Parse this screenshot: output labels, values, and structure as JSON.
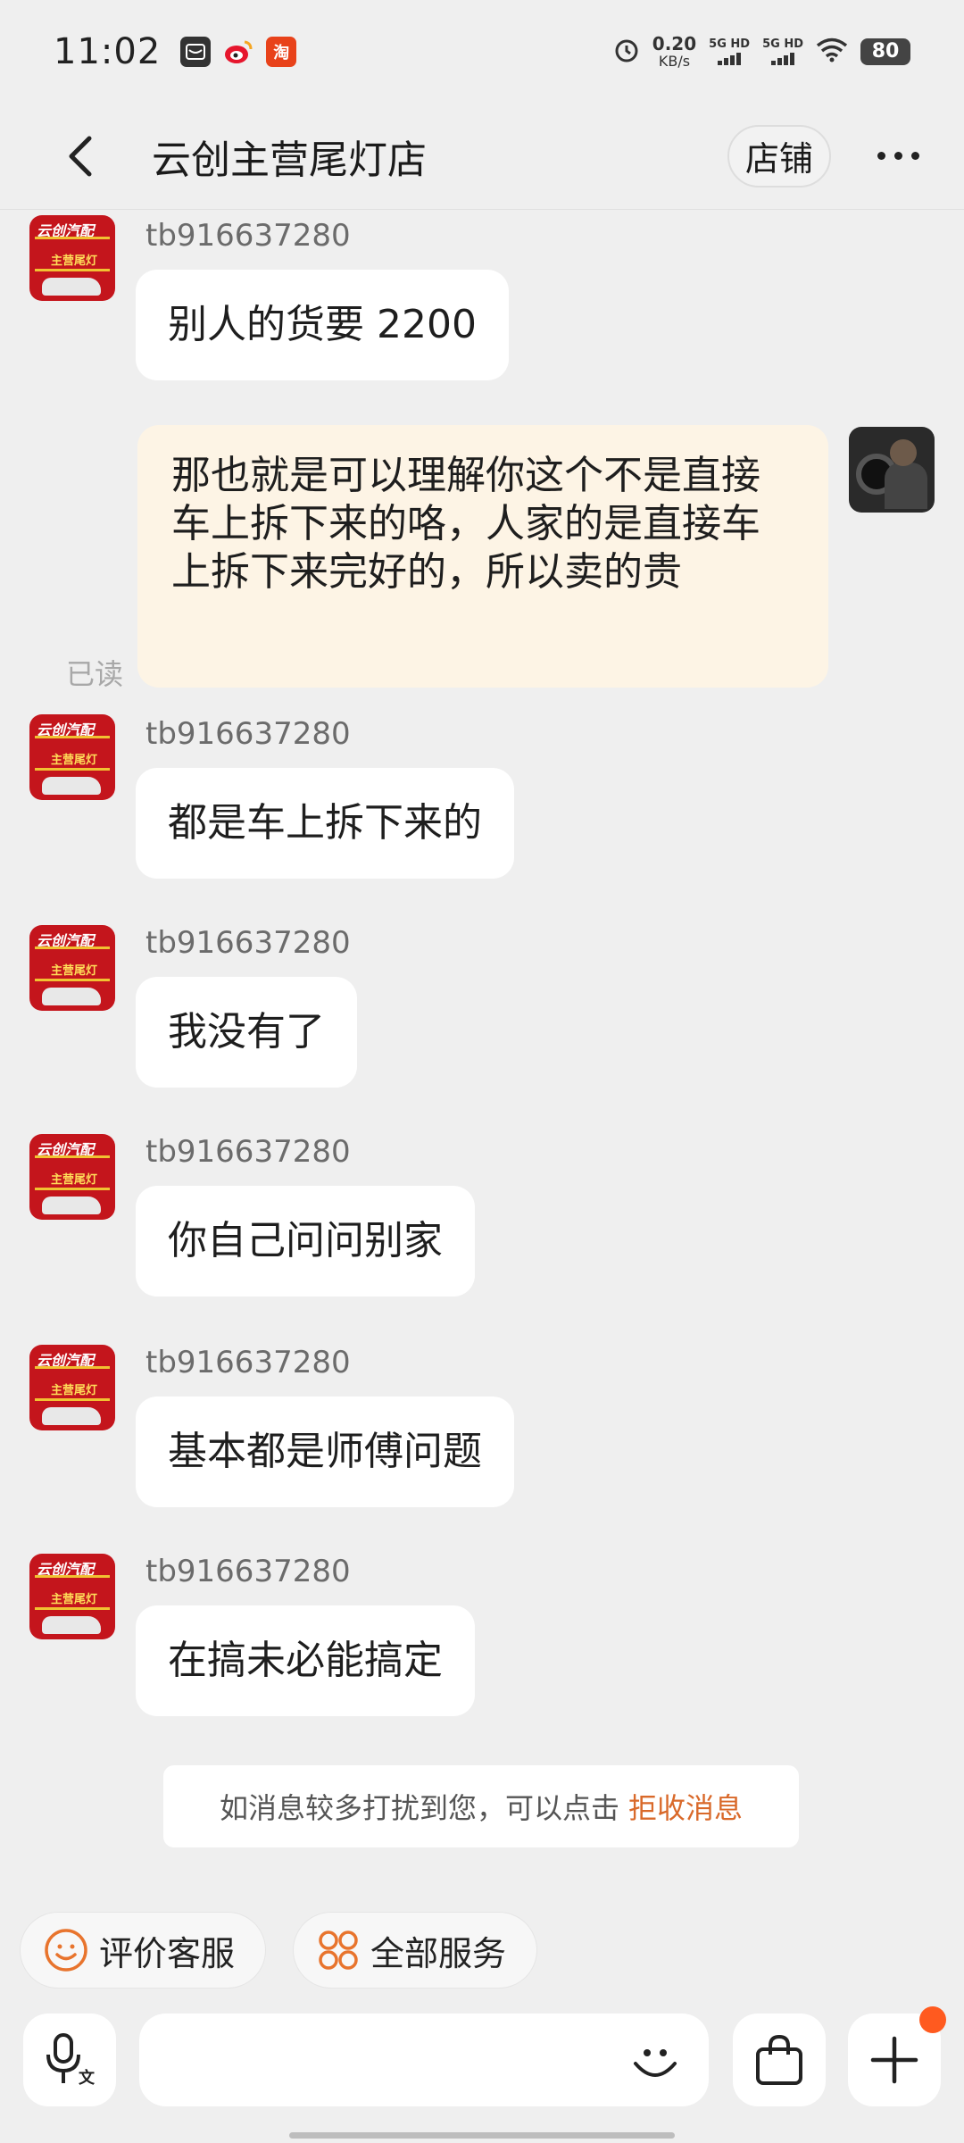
{
  "status_bar": {
    "time": "11:02",
    "net_speed": "0.20",
    "net_unit": "KB/s",
    "sim1": "5G HD",
    "sim2": "5G HD",
    "battery": "80",
    "app_tao": "淘"
  },
  "header": {
    "title": "云创主营尾灯店",
    "shop_button": "店铺"
  },
  "messages": [
    {
      "sender": "tb916637280",
      "text": "别人的货要 2200"
    },
    {
      "text": "那也就是可以理解你这个不是直接车上拆下来的咯，人家的是直接车上拆下来完好的，所以卖的贵",
      "status": "已读"
    },
    {
      "sender": "tb916637280",
      "text": "都是车上拆下来的"
    },
    {
      "sender": "tb916637280",
      "text": "我没有了"
    },
    {
      "sender": "tb916637280",
      "text": "你自己问问别家"
    },
    {
      "sender": "tb916637280",
      "text": "基本都是师傅问题"
    },
    {
      "sender": "tb916637280",
      "text": "在搞未必能搞定"
    }
  ],
  "notice": {
    "text": "如消息较多打扰到您，可以点击",
    "link": "拒收消息"
  },
  "quick_actions": {
    "rate": "评价客服",
    "services": "全部服务"
  },
  "input": {
    "placeholder": "",
    "voice_icon_text": "文"
  },
  "colors": {
    "accent": "#d9692a",
    "my_bubble": "#fdf4e5",
    "background": "#efefef"
  }
}
